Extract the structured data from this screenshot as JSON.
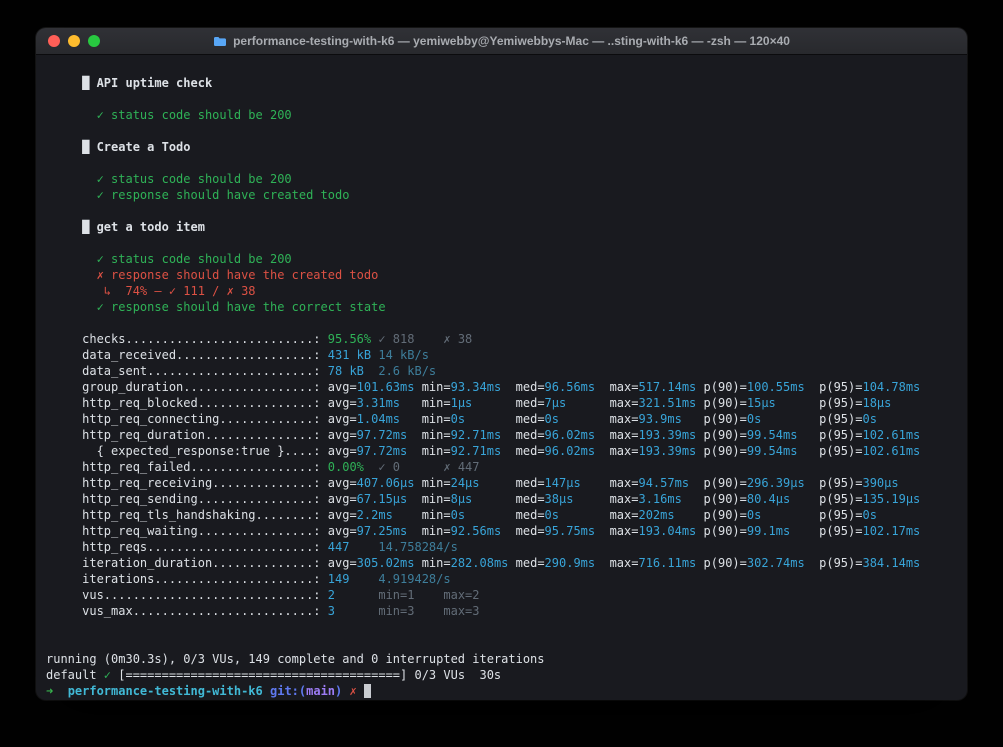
{
  "window": {
    "title": "performance-testing-with-k6 — yemiwebby@Yemiwebbys-Mac — ..sting-with-k6 — -zsh — 120×40"
  },
  "colors": {
    "termbg": "#191a1f",
    "white": "#dde1e6",
    "green": "#2fb257",
    "red": "#dd5144",
    "cyan": "#38a4d8",
    "dim": "#626c77",
    "dimcyan": "#3e7e9b",
    "arrow": "#37b24d",
    "dir": "#41b9d6",
    "gitblue": "#5f79f0",
    "branch": "#9d7cf4",
    "cursor": "#c9ccd1",
    "tlred": "#ff5f57",
    "tlyellow": "#febc2e",
    "tlgreen": "#28c840",
    "folder": "#58a6f5"
  },
  "terminal": {
    "name_col_width": 32,
    "lines": [
      {},
      {
        "seg": [
          [
            "wb",
            "     █ API uptime check"
          ]
        ]
      },
      {},
      {
        "seg": [
          [
            "g",
            "       ✓ status code should be 200"
          ]
        ]
      },
      {},
      {
        "seg": [
          [
            "wb",
            "     █ Create a Todo"
          ]
        ]
      },
      {},
      {
        "seg": [
          [
            "g",
            "       ✓ status code should be 200"
          ]
        ]
      },
      {
        "seg": [
          [
            "g",
            "       ✓ response should have created todo"
          ]
        ]
      },
      {},
      {
        "seg": [
          [
            "wb",
            "     █ get a todo item"
          ]
        ]
      },
      {},
      {
        "seg": [
          [
            "g",
            "       ✓ status code should be 200"
          ]
        ]
      },
      {
        "seg": [
          [
            "r",
            "       ✗ response should have the created todo"
          ]
        ]
      },
      {
        "seg": [
          [
            "r",
            "        ↳  74% — ✓ 111 / ✗ 38"
          ]
        ]
      },
      {
        "seg": [
          [
            "g",
            "       ✓ response should have the correct state"
          ]
        ]
      },
      {},
      {
        "metric": {
          "name": "checks",
          "cells": [
            {
              "t": "95.56%",
              "c": "g",
              "w": 7
            },
            {
              "t": "✓ 818",
              "c": "d",
              "w": 9
            },
            {
              "t": "✗ 38",
              "c": "d"
            }
          ]
        }
      },
      {
        "metric": {
          "name": "data_received",
          "cells": [
            {
              "t": "431 kB",
              "c": "c",
              "w": 7
            },
            {
              "t": "14 kB/s",
              "c": "dc"
            }
          ]
        }
      },
      {
        "metric": {
          "name": "data_sent",
          "cells": [
            {
              "t": "78 kB",
              "c": "c",
              "w": 7
            },
            {
              "t": "2.6 kB/s",
              "c": "dc"
            }
          ]
        }
      },
      {
        "metric": {
          "name": "group_duration",
          "cells": [
            {
              "l": "avg=",
              "v": "101.63ms",
              "w": 13
            },
            {
              "l": "min=",
              "v": "93.34ms",
              "w": 13
            },
            {
              "l": "med=",
              "v": "96.56ms",
              "w": 13
            },
            {
              "l": "max=",
              "v": "517.14ms",
              "w": 13
            },
            {
              "l": "p(90)=",
              "v": "100.55ms",
              "w": 16
            },
            {
              "l": "p(95)=",
              "v": "104.78ms"
            }
          ]
        }
      },
      {
        "metric": {
          "name": "http_req_blocked",
          "cells": [
            {
              "l": "avg=",
              "v": "3.31ms",
              "w": 13
            },
            {
              "l": "min=",
              "v": "1µs",
              "w": 13
            },
            {
              "l": "med=",
              "v": "7µs",
              "w": 13
            },
            {
              "l": "max=",
              "v": "321.51ms",
              "w": 13
            },
            {
              "l": "p(90)=",
              "v": "15µs",
              "w": 16
            },
            {
              "l": "p(95)=",
              "v": "18µs"
            }
          ]
        }
      },
      {
        "metric": {
          "name": "http_req_connecting",
          "cells": [
            {
              "l": "avg=",
              "v": "1.04ms",
              "w": 13
            },
            {
              "l": "min=",
              "v": "0s",
              "w": 13
            },
            {
              "l": "med=",
              "v": "0s",
              "w": 13
            },
            {
              "l": "max=",
              "v": "93.9ms",
              "w": 13
            },
            {
              "l": "p(90)=",
              "v": "0s",
              "w": 16
            },
            {
              "l": "p(95)=",
              "v": "0s"
            }
          ]
        }
      },
      {
        "metric": {
          "name": "http_req_duration",
          "cells": [
            {
              "l": "avg=",
              "v": "97.72ms",
              "w": 13
            },
            {
              "l": "min=",
              "v": "92.71ms",
              "w": 13
            },
            {
              "l": "med=",
              "v": "96.02ms",
              "w": 13
            },
            {
              "l": "max=",
              "v": "193.39ms",
              "w": 13
            },
            {
              "l": "p(90)=",
              "v": "99.54ms",
              "w": 16
            },
            {
              "l": "p(95)=",
              "v": "102.61ms"
            }
          ]
        }
      },
      {
        "metric": {
          "name": "  { expected_response:true }",
          "cells": [
            {
              "l": "avg=",
              "v": "97.72ms",
              "w": 13
            },
            {
              "l": "min=",
              "v": "92.71ms",
              "w": 13
            },
            {
              "l": "med=",
              "v": "96.02ms",
              "w": 13
            },
            {
              "l": "max=",
              "v": "193.39ms",
              "w": 13
            },
            {
              "l": "p(90)=",
              "v": "99.54ms",
              "w": 16
            },
            {
              "l": "p(95)=",
              "v": "102.61ms"
            }
          ]
        }
      },
      {
        "metric": {
          "name": "http_req_failed",
          "cells": [
            {
              "t": "0.00%",
              "c": "g",
              "w": 7
            },
            {
              "t": "✓ 0",
              "c": "d",
              "w": 9
            },
            {
              "t": "✗ 447",
              "c": "d"
            }
          ]
        }
      },
      {
        "metric": {
          "name": "http_req_receiving",
          "cells": [
            {
              "l": "avg=",
              "v": "407.06µs",
              "w": 13
            },
            {
              "l": "min=",
              "v": "24µs",
              "w": 13
            },
            {
              "l": "med=",
              "v": "147µs",
              "w": 13
            },
            {
              "l": "max=",
              "v": "94.57ms",
              "w": 13
            },
            {
              "l": "p(90)=",
              "v": "296.39µs",
              "w": 16
            },
            {
              "l": "p(95)=",
              "v": "390µs"
            }
          ]
        }
      },
      {
        "metric": {
          "name": "http_req_sending",
          "cells": [
            {
              "l": "avg=",
              "v": "67.15µs",
              "w": 13
            },
            {
              "l": "min=",
              "v": "8µs",
              "w": 13
            },
            {
              "l": "med=",
              "v": "38µs",
              "w": 13
            },
            {
              "l": "max=",
              "v": "3.16ms",
              "w": 13
            },
            {
              "l": "p(90)=",
              "v": "80.4µs",
              "w": 16
            },
            {
              "l": "p(95)=",
              "v": "135.19µs"
            }
          ]
        }
      },
      {
        "metric": {
          "name": "http_req_tls_handshaking",
          "cells": [
            {
              "l": "avg=",
              "v": "2.2ms",
              "w": 13
            },
            {
              "l": "min=",
              "v": "0s",
              "w": 13
            },
            {
              "l": "med=",
              "v": "0s",
              "w": 13
            },
            {
              "l": "max=",
              "v": "202ms",
              "w": 13
            },
            {
              "l": "p(90)=",
              "v": "0s",
              "w": 16
            },
            {
              "l": "p(95)=",
              "v": "0s"
            }
          ]
        }
      },
      {
        "metric": {
          "name": "http_req_waiting",
          "cells": [
            {
              "l": "avg=",
              "v": "97.25ms",
              "w": 13
            },
            {
              "l": "min=",
              "v": "92.56ms",
              "w": 13
            },
            {
              "l": "med=",
              "v": "95.75ms",
              "w": 13
            },
            {
              "l": "max=",
              "v": "193.04ms",
              "w": 13
            },
            {
              "l": "p(90)=",
              "v": "99.1ms",
              "w": 16
            },
            {
              "l": "p(95)=",
              "v": "102.17ms"
            }
          ]
        }
      },
      {
        "metric": {
          "name": "http_reqs",
          "cells": [
            {
              "t": "447",
              "c": "c",
              "w": 7
            },
            {
              "t": "14.758284/s",
              "c": "dc"
            }
          ]
        }
      },
      {
        "metric": {
          "name": "iteration_duration",
          "cells": [
            {
              "l": "avg=",
              "v": "305.02ms",
              "w": 13
            },
            {
              "l": "min=",
              "v": "282.08ms",
              "w": 13
            },
            {
              "l": "med=",
              "v": "290.9ms",
              "w": 13
            },
            {
              "l": "max=",
              "v": "716.11ms",
              "w": 13
            },
            {
              "l": "p(90)=",
              "v": "302.74ms",
              "w": 16
            },
            {
              "l": "p(95)=",
              "v": "384.14ms"
            }
          ]
        }
      },
      {
        "metric": {
          "name": "iterations",
          "cells": [
            {
              "t": "149",
              "c": "c",
              "w": 7
            },
            {
              "t": "4.919428/s",
              "c": "dc"
            }
          ]
        }
      },
      {
        "metric": {
          "name": "vus",
          "cells": [
            {
              "t": "2",
              "c": "c",
              "w": 7
            },
            {
              "t": "min=1",
              "c": "d",
              "w": 9
            },
            {
              "t": "max=2",
              "c": "d"
            }
          ]
        }
      },
      {
        "metric": {
          "name": "vus_max",
          "cells": [
            {
              "t": "3",
              "c": "c",
              "w": 7
            },
            {
              "t": "min=3",
              "c": "d",
              "w": 9
            },
            {
              "t": "max=3",
              "c": "d"
            }
          ]
        }
      },
      {},
      {},
      {
        "seg": [
          [
            "w",
            "running (0m30.3s), 0/3 VUs, 149 complete and 0 interrupted iterations"
          ]
        ]
      },
      {
        "seg": [
          [
            "w",
            "default "
          ],
          [
            "g",
            "✓"
          ],
          [
            "w",
            " [======================================] 0/3 VUs  30s"
          ]
        ]
      },
      {
        "seg": [
          [
            "ar",
            "➜"
          ],
          [
            "w",
            "  "
          ],
          [
            "dir",
            "performance-testing-with-k6"
          ],
          [
            "w",
            " "
          ],
          [
            "gb",
            "git:("
          ],
          [
            "br",
            "main"
          ],
          [
            "gb",
            ") "
          ],
          [
            "r",
            "✗"
          ],
          [
            "w",
            " "
          ],
          [
            "cur",
            " "
          ]
        ]
      }
    ]
  }
}
